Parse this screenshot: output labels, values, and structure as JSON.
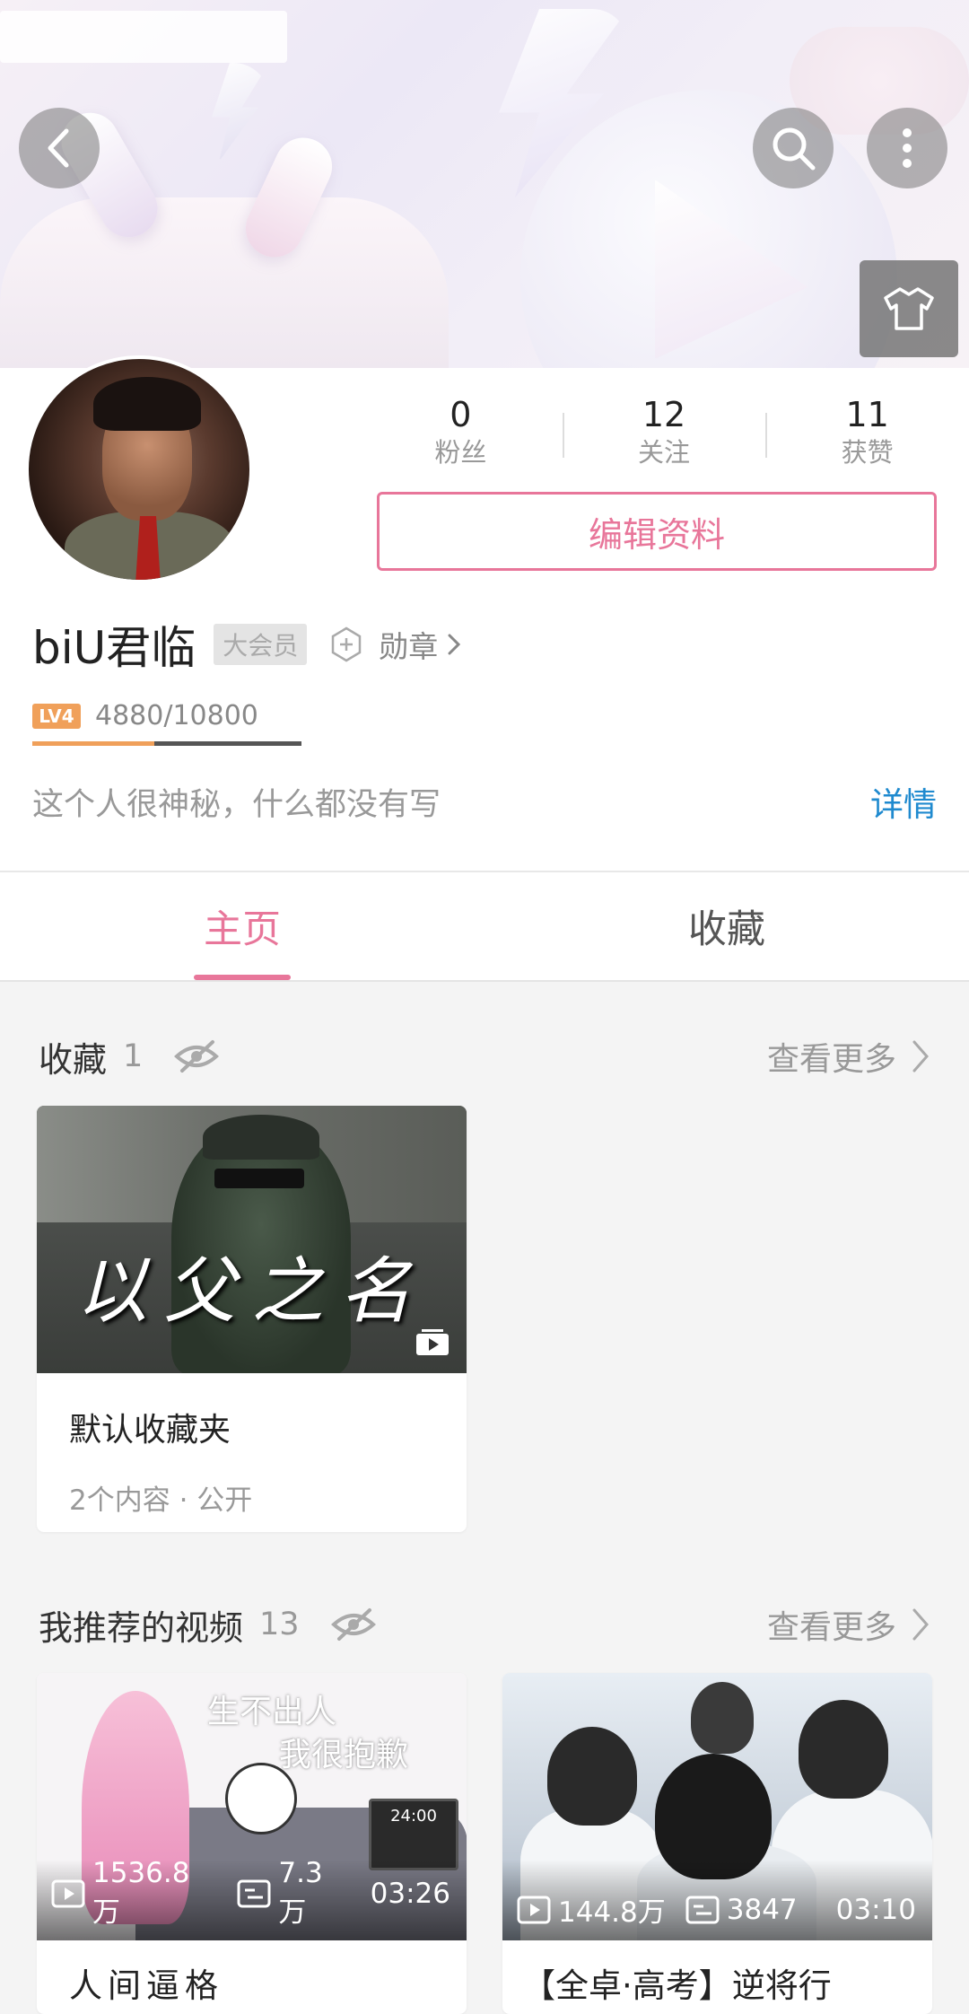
{
  "header": {
    "back_icon": "back-arrow-icon",
    "search_icon": "search-icon",
    "more_icon": "more-vertical-icon",
    "skin_icon": "tshirt-icon"
  },
  "profile": {
    "stats": [
      {
        "num": "0",
        "label": "粉丝"
      },
      {
        "num": "12",
        "label": "关注"
      },
      {
        "num": "11",
        "label": "获赞"
      }
    ],
    "edit_label": "编辑资料",
    "username": "biU君临",
    "vip_label": "大会员",
    "medal_label": "勋章",
    "level_badge": "LV4",
    "exp_text": "4880/10800",
    "exp_progress": 0.452,
    "bio": "这个人很神秘，什么都没有写",
    "detail_label": "详情"
  },
  "tabs": [
    {
      "label": "主页",
      "active": true
    },
    {
      "label": "收藏",
      "active": false
    }
  ],
  "favorites": {
    "title": "收藏",
    "count": "1",
    "more_label": "查看更多",
    "items": [
      {
        "thumb_caption": "以父之名",
        "title": "默认收藏夹",
        "meta": "2个内容 · 公开"
      }
    ]
  },
  "recommended": {
    "title": "我推荐的视频",
    "count": "13",
    "more_label": "查看更多",
    "items": [
      {
        "views": "1536.8万",
        "danmaku": "7.3万",
        "duration": "03:26",
        "title": "人间逼格",
        "thumb_text_1": "生不出人",
        "thumb_text_2": "我很抱歉",
        "monitor_text": "24:00"
      },
      {
        "views": "144.8万",
        "danmaku": "3847",
        "duration": "03:10",
        "title": "【全卓·高考】逆将行"
      }
    ]
  },
  "colors": {
    "accent_pink": "#e8769a",
    "link_blue": "#1f8acf",
    "level_orange": "#f0a05a"
  }
}
